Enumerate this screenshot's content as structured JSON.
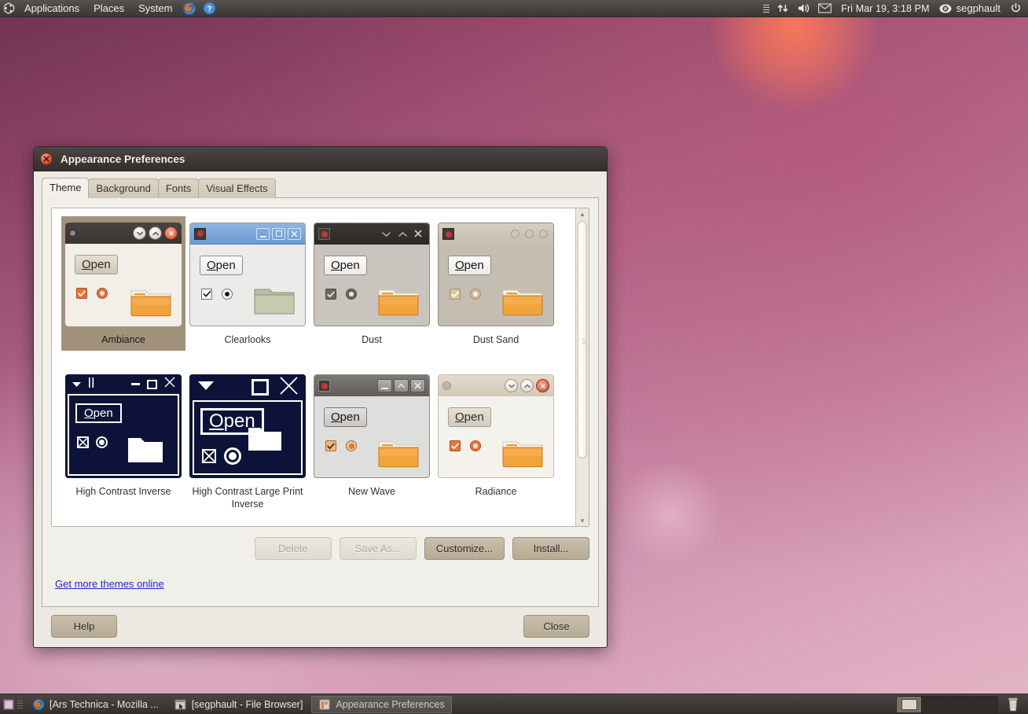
{
  "panel": {
    "logo_icon": "ubuntu-logo-icon",
    "menus": [
      "Applications",
      "Places",
      "System"
    ],
    "launchers": [
      {
        "name": "firefox-launcher-icon",
        "title": "Firefox Web Browser"
      },
      {
        "name": "help-launcher-icon",
        "title": "Ubuntu Help Center"
      }
    ],
    "indicators": [
      {
        "name": "list-indicator-icon"
      },
      {
        "name": "network-transfer-icon"
      },
      {
        "name": "volume-icon"
      },
      {
        "name": "messaging-envelope-icon"
      }
    ],
    "clock": "Fri Mar 19,  3:18 PM",
    "user": "segphault",
    "user_icon": "user-status-busy-icon",
    "power_icon": "power-icon"
  },
  "window": {
    "title": "Appearance Preferences",
    "close_icon": "window-close-icon",
    "tabs": [
      {
        "label": "Theme",
        "active": true
      },
      {
        "label": "Background",
        "active": false
      },
      {
        "label": "Fonts",
        "active": false
      },
      {
        "label": "Visual Effects",
        "active": false
      }
    ],
    "themes": [
      {
        "name": "Ambiance",
        "selected": true,
        "style": "ambiance",
        "bar_bg": "#3f3b38",
        "body_bg": "#f2efe9",
        "text": "#2d2a26",
        "btn_bg": "#d6cfc1",
        "accent": "#f07746",
        "folder": "#f2a33c",
        "controls": [
          "dot",
          "minimize-circle",
          "maximize-circle",
          "close-circle"
        ]
      },
      {
        "name": "Clearlooks",
        "selected": false,
        "style": "clearlooks",
        "bar_bg": "#7aa3d4",
        "body_bg": "#ecebe9",
        "text": "#1e1e1e",
        "btn_bg": "#f6f5f4",
        "accent": "#ffffff",
        "folder": "#b7bba0",
        "controls": [
          "app-red",
          "minimize-box",
          "maximize-box",
          "close-box"
        ]
      },
      {
        "name": "Dust",
        "selected": false,
        "style": "dust",
        "bar_bg": "#322f2c",
        "body_bg": "#c9c4bd",
        "text": "#1f1d1b",
        "btn_bg": "#f4f2ef",
        "accent": "#ffffff",
        "folder": "#f2a33c",
        "controls": [
          "app-red",
          "chev-down",
          "chev-up",
          "x"
        ]
      },
      {
        "name": "Dust Sand",
        "selected": false,
        "style": "dustsand",
        "bar_bg": "#c4bdb1",
        "body_bg": "#c4bdb1",
        "text": "#1f1d1b",
        "btn_bg": "#f4f2ef",
        "accent": "#d9b46a",
        "folder": "#f2a33c",
        "controls": [
          "app-red",
          "circle",
          "circle",
          "circle"
        ]
      },
      {
        "name": "High Contrast Inverse",
        "selected": false,
        "style": "hci",
        "bar_bg": "#0d1338",
        "body_bg": "#0d1338",
        "text": "#ffffff",
        "btn_bg": "#0d1338",
        "accent": "#ffffff",
        "folder": "#ffffff",
        "controls": [
          "tri-down",
          "bars",
          "minimize-line",
          "square",
          "x-thin"
        ]
      },
      {
        "name": "High Contrast Large Print Inverse",
        "selected": false,
        "style": "hclpi",
        "bar_bg": "#0d1338",
        "body_bg": "#0d1338",
        "text": "#ffffff",
        "btn_bg": "#0d1338",
        "accent": "#ffffff",
        "folder": "#ffffff",
        "controls": [
          "tri-down-big",
          "square-big",
          "x-big"
        ]
      },
      {
        "name": "New Wave",
        "selected": false,
        "style": "newwave",
        "bar_bg": "#6d6a66",
        "body_bg": "#dededd",
        "text": "#1f1d1b",
        "btn_bg": "#d2d0ce",
        "accent": "#e88d20",
        "folder": "#f2a33c",
        "controls": [
          "app-red",
          "minimize-btn",
          "maximize-btn",
          "close-btn"
        ]
      },
      {
        "name": "Radiance",
        "selected": false,
        "style": "radiance",
        "bar_bg": "#dbd3c4",
        "body_bg": "#f4f2ed",
        "text": "#2d2a26",
        "btn_bg": "#dcd5c8",
        "accent": "#f07746",
        "folder": "#f2a33c",
        "controls": [
          "dot",
          "minimize-circle",
          "maximize-circle",
          "close-circle"
        ]
      }
    ],
    "thumb_button_label": "Open",
    "thumb_button_mnemonic": "O",
    "actions": [
      {
        "label": "Delete",
        "enabled": false,
        "name": "delete-button"
      },
      {
        "label": "Save As...",
        "enabled": false,
        "name": "save-as-button"
      },
      {
        "label": "Customize...",
        "enabled": true,
        "name": "customize-button"
      },
      {
        "label": "Install...",
        "enabled": true,
        "name": "install-button"
      }
    ],
    "more_themes_link": "Get more themes online",
    "help_button": "Help",
    "close_button": "Close"
  },
  "taskbar": {
    "show_desktop_icon": "show-desktop-icon",
    "tasks": [
      {
        "label": "[Ars Technica - Mozilla ...",
        "icon": "firefox-icon",
        "active": false
      },
      {
        "label": "[segphault - File Browser]",
        "icon": "file-browser-icon",
        "active": false
      },
      {
        "label": "Appearance Preferences",
        "icon": "appearance-icon",
        "active": true
      }
    ],
    "workspaces": [
      {
        "active": true
      },
      {
        "active": false
      },
      {
        "active": false
      },
      {
        "active": false
      }
    ],
    "trash_icon": "trash-icon"
  }
}
